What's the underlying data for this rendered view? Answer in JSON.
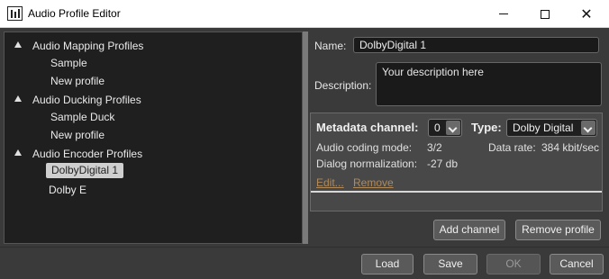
{
  "window": {
    "title": "Audio Profile Editor",
    "app_icon": "audio-levels-icon",
    "controls": [
      "minimize-icon",
      "maximize-icon",
      "close-icon"
    ]
  },
  "tree": {
    "groups": [
      {
        "label": "Audio Mapping Profiles",
        "items": [
          "Sample",
          "New profile"
        ]
      },
      {
        "label": "Audio Ducking Profiles",
        "items": [
          "Sample Duck",
          "New profile"
        ]
      },
      {
        "label": "Audio Encoder Profiles",
        "items": [
          "DolbyDigital 1",
          "Dolby E"
        ]
      }
    ],
    "selected": "DolbyDigital 1"
  },
  "profile": {
    "name_label": "Name:",
    "name_value": "DolbyDigital 1",
    "description_label": "Description:",
    "description_value": "Your description here"
  },
  "channel": {
    "metadata_label": "Metadata channel:",
    "metadata_value": "0",
    "type_label": "Type:",
    "type_value": "Dolby Digital",
    "coding_mode_label": "Audio coding mode:",
    "coding_mode_value": "3/2",
    "data_rate_label": "Data rate:",
    "data_rate_value": "384 kbit/sec",
    "dialog_norm_label": "Dialog normalization:",
    "dialog_norm_value": "-27 db",
    "edit_link": "Edit...",
    "remove_link": "Remove"
  },
  "actions": {
    "add_channel": "Add channel",
    "remove_profile": "Remove profile"
  },
  "footer": {
    "load": "Load",
    "save": "Save",
    "ok": "OK",
    "cancel": "Cancel"
  },
  "colors": {
    "background": "#3a3a3a",
    "tree_background": "#1f1f1f",
    "link": "#b08a5a",
    "selected_item": "#cfcfcf"
  }
}
